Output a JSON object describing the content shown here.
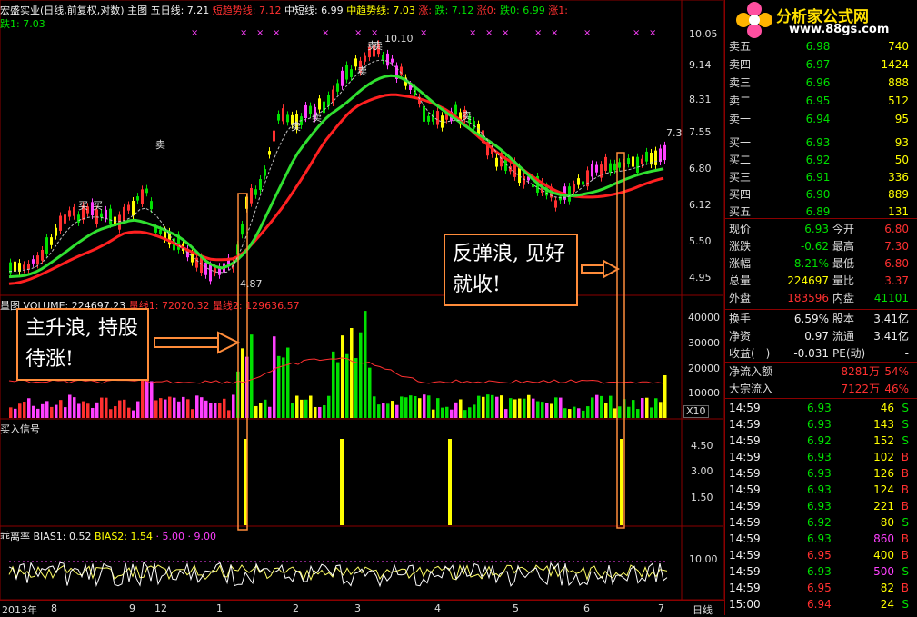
{
  "main_header": {
    "title": "宏盛实业(日线,前复权,对数) 主图",
    "ma5": "五日线: 7.21",
    "short_trend": "短趋势线: 7.12",
    "mid_short": "中短线: 6.99",
    "mid_trend": "中趋势线: 7.03",
    "up": "涨: ",
    "down": "跌: 7.12",
    "up0": "涨0: ",
    "down0": "跌0: 6.99",
    "up1": "涨1: ",
    "down1": "跌1: 7.03"
  },
  "price_axis": [
    "10.05",
    "9.14",
    "8.31",
    "7.55",
    "6.80",
    "6.12",
    "5.50",
    "4.95"
  ],
  "price_marks": {
    "high": "10.10",
    "low": "4.87",
    "last": "7.3"
  },
  "sell_marks": [
    "卖",
    "卖",
    "卖",
    "卖",
    "卖",
    "卖",
    "卖"
  ],
  "buy_marks": [
    "买",
    "买"
  ],
  "volume_header": {
    "title": "量图 VOLUME: 224697.23",
    "ma1": "量线1: 72020.32",
    "ma2": "量线2: 129636.57"
  },
  "volume_axis": [
    "40000",
    "30000",
    "20000",
    "10000"
  ],
  "volume_unit": "X10",
  "signal_header": "买入信号",
  "signal_axis": [
    "4.50",
    "3.00",
    "1.50"
  ],
  "bias_header": {
    "title": "乖离率",
    "bias1": "BIAS1: 0.52",
    "bias2": "BIAS2: 1.54",
    "extra": "· 5.00 · 9.00"
  },
  "bias_axis": [
    "10.00"
  ],
  "time_axis": [
    "2013年",
    "8",
    "9",
    "12",
    "1",
    "2",
    "3",
    "4",
    "5",
    "6",
    "7"
  ],
  "period": "日线",
  "callouts": {
    "left": "主升浪, 持股待涨!",
    "right": "反弹浪, 见好就收!"
  },
  "logo": {
    "name": "分析家公式网",
    "url": "www.88gs.com"
  },
  "order_book": {
    "sell": [
      {
        "label": "卖五",
        "price": "6.98",
        "vol": "740"
      },
      {
        "label": "卖四",
        "price": "6.97",
        "vol": "1424"
      },
      {
        "label": "卖三",
        "price": "6.96",
        "vol": "888"
      },
      {
        "label": "卖二",
        "price": "6.95",
        "vol": "512"
      },
      {
        "label": "卖一",
        "price": "6.94",
        "vol": "95"
      }
    ],
    "buy": [
      {
        "label": "买一",
        "price": "6.93",
        "vol": "93"
      },
      {
        "label": "买二",
        "price": "6.92",
        "vol": "50"
      },
      {
        "label": "买三",
        "price": "6.91",
        "vol": "336"
      },
      {
        "label": "买四",
        "price": "6.90",
        "vol": "889"
      },
      {
        "label": "买五",
        "price": "6.89",
        "vol": "131"
      }
    ]
  },
  "quote": [
    {
      "l1": "现价",
      "v1": "6.93",
      "l2": "今开",
      "v2": "6.80",
      "c1": "green",
      "c2": "red"
    },
    {
      "l1": "涨跌",
      "v1": "-0.62",
      "l2": "最高",
      "v2": "7.30",
      "c1": "green",
      "c2": "red"
    },
    {
      "l1": "涨幅",
      "v1": "-8.21%",
      "l2": "最低",
      "v2": "6.80",
      "c1": "green",
      "c2": "red"
    },
    {
      "l1": "总量",
      "v1": "224697",
      "l2": "量比",
      "v2": "3.37",
      "c1": "yellow",
      "c2": "red"
    },
    {
      "l1": "外盘",
      "v1": "183596",
      "l2": "内盘",
      "v2": "41101",
      "c1": "red",
      "c2": "green"
    }
  ],
  "fundamentals": [
    {
      "l1": "换手",
      "v1": "6.59%",
      "l2": "股本",
      "v2": "3.41亿"
    },
    {
      "l1": "净资",
      "v1": "0.97",
      "l2": "流通",
      "v2": "3.41亿"
    },
    {
      "l1": "收益(一)",
      "v1": "-0.031",
      "l2": "PE(动)",
      "v2": "-"
    }
  ],
  "flows": [
    {
      "label": "净流入额",
      "value": "8281万",
      "pct": "54%"
    },
    {
      "label": "大宗流入",
      "value": "7122万",
      "pct": "46%"
    }
  ],
  "ticks": [
    {
      "time": "14:59",
      "price": "6.93",
      "vol": "46",
      "side": "S"
    },
    {
      "time": "14:59",
      "price": "6.93",
      "vol": "143",
      "side": "S"
    },
    {
      "time": "14:59",
      "price": "6.92",
      "vol": "152",
      "side": "S"
    },
    {
      "time": "14:59",
      "price": "6.93",
      "vol": "102",
      "side": "B"
    },
    {
      "time": "14:59",
      "price": "6.93",
      "vol": "126",
      "side": "B"
    },
    {
      "time": "14:59",
      "price": "6.93",
      "vol": "124",
      "side": "B"
    },
    {
      "time": "14:59",
      "price": "6.93",
      "vol": "221",
      "side": "B"
    },
    {
      "time": "14:59",
      "price": "6.92",
      "vol": "80",
      "side": "S"
    },
    {
      "time": "14:59",
      "price": "6.93",
      "vol": "860",
      "side": "B"
    },
    {
      "time": "14:59",
      "price": "6.95",
      "vol": "400",
      "side": "B"
    },
    {
      "time": "14:59",
      "price": "6.93",
      "vol": "500",
      "side": "S"
    },
    {
      "time": "14:59",
      "price": "6.95",
      "vol": "82",
      "side": "B"
    },
    {
      "time": "15:00",
      "price": "6.94",
      "vol": "24",
      "side": "S"
    }
  ],
  "colors": {
    "up": "#ff3030",
    "down": "#00e000",
    "panel_border": "#8b0000",
    "callout": "#ff8c3a",
    "signal": "#ffff00"
  }
}
